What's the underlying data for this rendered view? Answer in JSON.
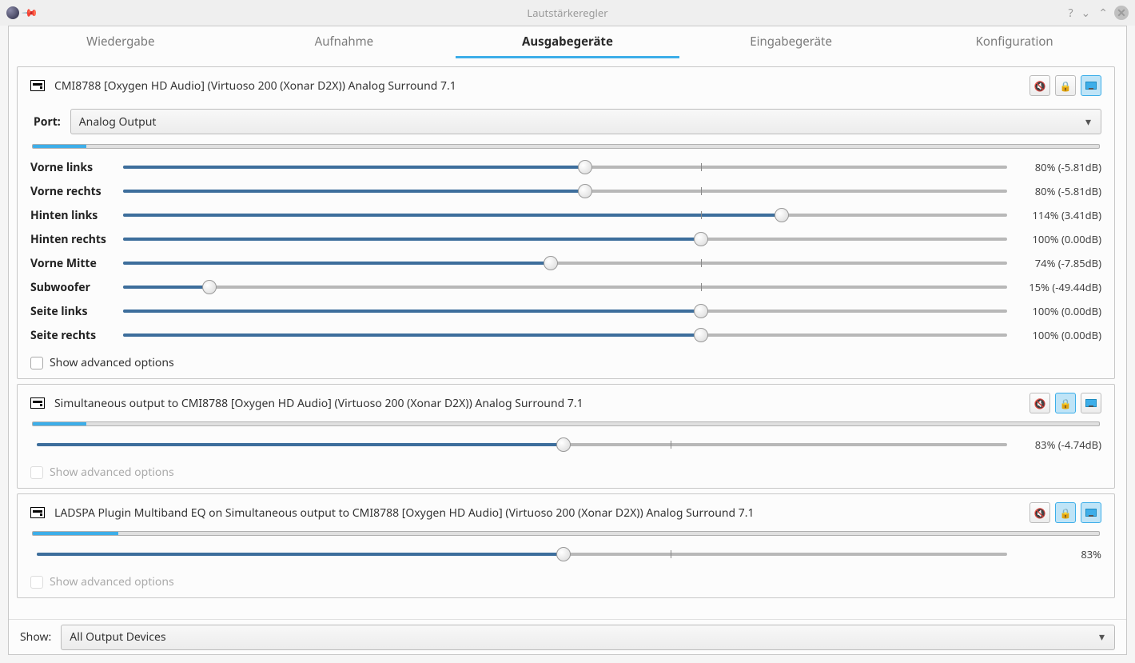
{
  "window": {
    "title": "Lautstärkeregler"
  },
  "tabs": [
    {
      "label": "Wiedergabe"
    },
    {
      "label": "Aufnahme"
    },
    {
      "label": "Ausgabegeräte",
      "active": true
    },
    {
      "label": "Eingabegeräte"
    },
    {
      "label": "Konfiguration"
    }
  ],
  "devices": [
    {
      "name": "CMI8788 [Oxygen HD Audio] (Virtuoso 200 (Xonar D2X)) Analog Surround 7.1",
      "port_label": "Port:",
      "port_value": "Analog Output",
      "vu": 5,
      "channels": [
        {
          "label": "Vorne links",
          "pct": 80,
          "text": "80% (-5.81dB)"
        },
        {
          "label": "Vorne rechts",
          "pct": 80,
          "text": "80% (-5.81dB)"
        },
        {
          "label": "Hinten links",
          "pct": 114,
          "text": "114% (3.41dB)"
        },
        {
          "label": "Hinten rechts",
          "pct": 100,
          "text": "100% (0.00dB)"
        },
        {
          "label": "Vorne Mitte",
          "pct": 74,
          "text": "74% (-7.85dB)"
        },
        {
          "label": "Subwoofer",
          "pct": 15,
          "text": "15% (-49.44dB)"
        },
        {
          "label": "Seite links",
          "pct": 100,
          "text": "100% (0.00dB)"
        },
        {
          "label": "Seite rechts",
          "pct": 100,
          "text": "100% (0.00dB)"
        }
      ],
      "adv_label": "Show advanced options",
      "adv_enabled": true,
      "lock_active": false,
      "default_active": true
    },
    {
      "name": "Simultaneous output to CMI8788 [Oxygen HD Audio] (Virtuoso 200 (Xonar D2X)) Analog Surround 7.1",
      "vu": 5,
      "channels": [
        {
          "label": "",
          "pct": 83,
          "text": "83% (-4.74dB)"
        }
      ],
      "adv_label": "Show advanced options",
      "adv_enabled": false,
      "lock_active": true,
      "default_active": false
    },
    {
      "name": "LADSPA Plugin Multiband EQ on Simultaneous output to CMI8788 [Oxygen HD Audio] (Virtuoso 200 (Xonar D2X)) Analog Surround 7.1",
      "vu": 8,
      "channels": [
        {
          "label": "",
          "pct": 83,
          "text": "83%"
        }
      ],
      "adv_label": "Show advanced options",
      "adv_enabled": false,
      "lock_active": true,
      "default_active": true
    }
  ],
  "bottom": {
    "show_label": "Show:",
    "show_value": "All Output Devices"
  }
}
